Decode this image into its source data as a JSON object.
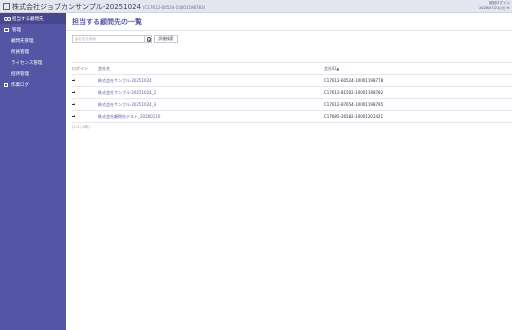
{
  "header": {
    "app_title": "株式会社ジョブカンサンプル-20251024",
    "app_subtitle": "(C17612-60524-10001198783)",
    "last_login_label": "前回ログイン",
    "last_login_value": "2026/07/21(火) 9:"
  },
  "sidebar": {
    "items": [
      {
        "label": "担当する顧問先",
        "icon": "people-icon"
      },
      {
        "label": "管理",
        "icon": "box-icon"
      },
      {
        "label": "顧問先管理"
      },
      {
        "label": "所員管理"
      },
      {
        "label": "ライセンス管理"
      },
      {
        "label": "招待管理"
      },
      {
        "label": "作業ログ",
        "icon": "doc-icon"
      }
    ]
  },
  "main": {
    "title": "担当する顧問先の一覧",
    "search": {
      "placeholder": "会社名を検索",
      "advanced_label": "詳細検索"
    },
    "table": {
      "headers": {
        "login": "ログイン",
        "name": "会社名",
        "id": "会社ID▲"
      },
      "rows": [
        {
          "name": "株式会社サンプル-20251024",
          "id": "C17612-60524-10001198778"
        },
        {
          "name": "株式会社サンプル-20251024_2",
          "id": "C17612-81502-10001198782"
        },
        {
          "name": "株式会社サンプル-20251024_3",
          "id": "C17612-87654-10001198795"
        },
        {
          "name": "株式会社顧問先テスト_20260116",
          "id": "C17685-26582-10001201421"
        }
      ]
    },
    "count_text": "(1-4 / 4件)"
  },
  "colors": {
    "sidebar_bg": "#5555a6",
    "accent": "#5a5aa6",
    "topbar_bg": "#e6e6f0"
  }
}
